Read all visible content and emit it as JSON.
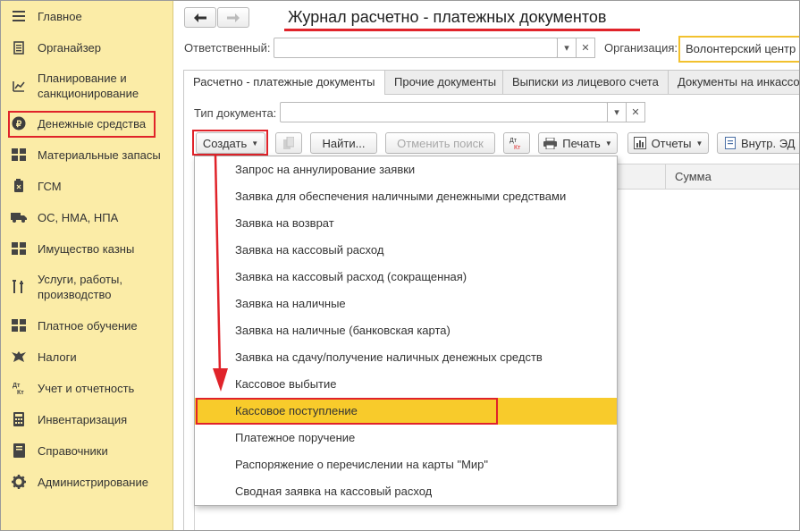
{
  "sidebar": {
    "items": [
      {
        "label": "Главное",
        "icon": "menu-icon"
      },
      {
        "label": "Органайзер",
        "icon": "organizer-icon"
      },
      {
        "label": "Планирование и санкционирование",
        "icon": "planning-icon"
      },
      {
        "label": "Денежные средства",
        "icon": "ruble-icon"
      },
      {
        "label": "Материальные запасы",
        "icon": "materials-icon"
      },
      {
        "label": "ГСМ",
        "icon": "fuel-icon"
      },
      {
        "label": "ОС, НМА, НПА",
        "icon": "truck-icon"
      },
      {
        "label": "Имущество казны",
        "icon": "treasury-icon"
      },
      {
        "label": "Услуги, работы, производство",
        "icon": "tools-icon"
      },
      {
        "label": "Платное обучение",
        "icon": "education-icon"
      },
      {
        "label": "Налоги",
        "icon": "eagle-icon"
      },
      {
        "label": "Учет и отчетность",
        "icon": "debit-credit-icon"
      },
      {
        "label": "Инвентаризация",
        "icon": "calculator-icon"
      },
      {
        "label": "Справочники",
        "icon": "book-icon"
      },
      {
        "label": "Администрирование",
        "icon": "gear-icon"
      }
    ]
  },
  "header": {
    "title": "Журнал расчетно - платежных документов",
    "back_icon": "arrow-left-icon",
    "forward_icon": "arrow-right-icon"
  },
  "filters": {
    "responsible_label": "Ответственный:",
    "responsible_value": "",
    "organization_label": "Организация:",
    "organization_value": "Волонтерский центр",
    "doc_type_label": "Тип документа:",
    "doc_type_value": ""
  },
  "tabs": [
    {
      "label": "Расчетно - платежные документы",
      "active": true
    },
    {
      "label": "Прочие документы",
      "active": false
    },
    {
      "label": "Выписки из лицевого счета",
      "active": false
    },
    {
      "label": "Документы на инкассо",
      "active": false
    }
  ],
  "toolbar": {
    "create_label": "Создать",
    "find_label": "Найти...",
    "cancel_search_label": "Отменить поиск",
    "print_label": "Печать",
    "reports_label": "Отчеты",
    "internal_ed_label": "Внутр. ЭД",
    "dtkt_label": "Дт Кт"
  },
  "table": {
    "columns": [
      "Сумма"
    ]
  },
  "dropdown": {
    "items": [
      "Запрос на аннулирование заявки",
      "Заявка для обеспечения наличными денежными средствами",
      "Заявка на возврат",
      "Заявка на кассовый расход",
      "Заявка на кассовый расход (сокращенная)",
      "Заявка на наличные",
      "Заявка на наличные (банковская карта)",
      "Заявка на сдачу/получение наличных денежных средств",
      "Кассовое выбытие",
      "Кассовое поступление",
      "Платежное поручение",
      "Распоряжение о перечислении на карты \"Мир\"",
      "Сводная заявка на кассовый расход"
    ],
    "selected_index": 9
  },
  "colors": {
    "sidebar_bg": "#fbeca7",
    "highlight": "#f8cb2b",
    "annotation_red": "#e0232a"
  }
}
